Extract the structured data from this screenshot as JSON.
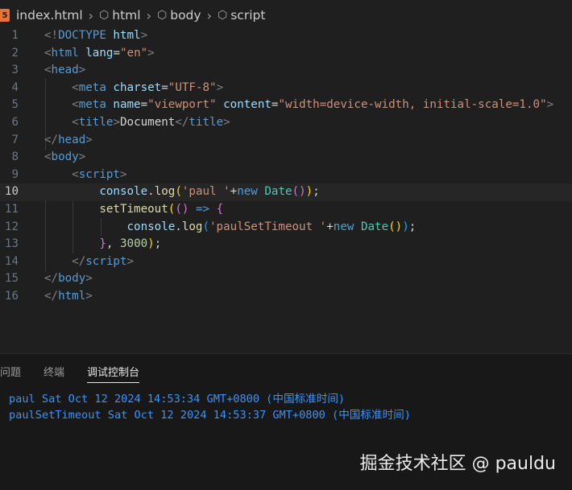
{
  "breadcrumb": {
    "file_icon_text": "5",
    "items": [
      "index.html",
      "html",
      "body",
      "script"
    ]
  },
  "editor": {
    "current_line": 10,
    "lines": [
      {
        "num": "1",
        "tokens": [
          [
            "<!",
            "t-punct"
          ],
          [
            "DOCTYPE",
            "t-tag"
          ],
          [
            " html",
            "t-attr"
          ],
          [
            ">",
            "t-punct"
          ]
        ]
      },
      {
        "num": "2",
        "tokens": [
          [
            "<",
            "t-punct"
          ],
          [
            "html",
            "t-tag"
          ],
          [
            " lang",
            "t-attr"
          ],
          [
            "=",
            "t-text"
          ],
          [
            "\"en\"",
            "t-str"
          ],
          [
            ">",
            "t-punct"
          ]
        ]
      },
      {
        "num": "3",
        "tokens": [
          [
            "<",
            "t-punct"
          ],
          [
            "head",
            "t-tag"
          ],
          [
            ">",
            "t-punct"
          ]
        ]
      },
      {
        "num": "4",
        "tokens": [
          [
            "    ",
            "t-text"
          ],
          [
            "<",
            "t-punct"
          ],
          [
            "meta",
            "t-tag"
          ],
          [
            " charset",
            "t-attr"
          ],
          [
            "=",
            "t-text"
          ],
          [
            "\"UTF-8\"",
            "t-str"
          ],
          [
            ">",
            "t-punct"
          ]
        ]
      },
      {
        "num": "5",
        "tokens": [
          [
            "    ",
            "t-text"
          ],
          [
            "<",
            "t-punct"
          ],
          [
            "meta",
            "t-tag"
          ],
          [
            " name",
            "t-attr"
          ],
          [
            "=",
            "t-text"
          ],
          [
            "\"viewport\"",
            "t-str"
          ],
          [
            " content",
            "t-attr"
          ],
          [
            "=",
            "t-text"
          ],
          [
            "\"width=device-width, initial-scale=1.0\"",
            "t-str"
          ],
          [
            ">",
            "t-punct"
          ]
        ]
      },
      {
        "num": "6",
        "tokens": [
          [
            "    ",
            "t-text"
          ],
          [
            "<",
            "t-punct"
          ],
          [
            "title",
            "t-tag"
          ],
          [
            ">",
            "t-punct"
          ],
          [
            "Document",
            "t-text"
          ],
          [
            "</",
            "t-punct"
          ],
          [
            "title",
            "t-tag"
          ],
          [
            ">",
            "t-punct"
          ]
        ]
      },
      {
        "num": "7",
        "tokens": [
          [
            "</",
            "t-punct"
          ],
          [
            "head",
            "t-tag"
          ],
          [
            ">",
            "t-punct"
          ]
        ]
      },
      {
        "num": "8",
        "tokens": [
          [
            "<",
            "t-punct"
          ],
          [
            "body",
            "t-tag"
          ],
          [
            ">",
            "t-punct"
          ]
        ]
      },
      {
        "num": "9",
        "tokens": [
          [
            "    ",
            "t-text"
          ],
          [
            "<",
            "t-punct"
          ],
          [
            "script",
            "t-tag"
          ],
          [
            ">",
            "t-punct"
          ]
        ]
      },
      {
        "num": "10",
        "tokens": [
          [
            "        ",
            "t-text"
          ],
          [
            "console",
            "t-attr"
          ],
          [
            ".",
            "t-text"
          ],
          [
            "log",
            "t-fn"
          ],
          [
            "(",
            "t-br1"
          ],
          [
            "'paul '",
            "t-str"
          ],
          [
            "+",
            "t-text"
          ],
          [
            "new",
            "t-kw"
          ],
          [
            " ",
            "t-text"
          ],
          [
            "Date",
            "t-cls"
          ],
          [
            "(",
            "t-br2"
          ],
          [
            ")",
            "t-br2"
          ],
          [
            ")",
            "t-br1"
          ],
          [
            ";",
            "t-text"
          ]
        ]
      },
      {
        "num": "11",
        "tokens": [
          [
            "        ",
            "t-text"
          ],
          [
            "setTimeout",
            "t-fn"
          ],
          [
            "(",
            "t-br1"
          ],
          [
            "(",
            "t-br2"
          ],
          [
            ")",
            "t-br2"
          ],
          [
            " ",
            "t-text"
          ],
          [
            "=>",
            "t-kw"
          ],
          [
            " ",
            "t-text"
          ],
          [
            "{",
            "t-br2"
          ]
        ]
      },
      {
        "num": "12",
        "tokens": [
          [
            "            ",
            "t-text"
          ],
          [
            "console",
            "t-attr"
          ],
          [
            ".",
            "t-text"
          ],
          [
            "log",
            "t-fn"
          ],
          [
            "(",
            "t-br3"
          ],
          [
            "'paulSetTimeout '",
            "t-str"
          ],
          [
            "+",
            "t-text"
          ],
          [
            "new",
            "t-kw"
          ],
          [
            " ",
            "t-text"
          ],
          [
            "Date",
            "t-cls"
          ],
          [
            "(",
            "t-br1"
          ],
          [
            ")",
            "t-br1"
          ],
          [
            ")",
            "t-br3"
          ],
          [
            ";",
            "t-text"
          ]
        ]
      },
      {
        "num": "13",
        "tokens": [
          [
            "        ",
            "t-text"
          ],
          [
            "}",
            "t-br2"
          ],
          [
            ", ",
            "t-text"
          ],
          [
            "3000",
            "t-num"
          ],
          [
            ")",
            "t-br1"
          ],
          [
            ";",
            "t-text"
          ]
        ]
      },
      {
        "num": "14",
        "tokens": [
          [
            "    ",
            "t-text"
          ],
          [
            "</",
            "t-punct"
          ],
          [
            "script",
            "t-tag"
          ],
          [
            ">",
            "t-punct"
          ]
        ]
      },
      {
        "num": "15",
        "tokens": [
          [
            "</",
            "t-punct"
          ],
          [
            "body",
            "t-tag"
          ],
          [
            ">",
            "t-punct"
          ]
        ]
      },
      {
        "num": "16",
        "tokens": [
          [
            "</",
            "t-punct"
          ],
          [
            "html",
            "t-tag"
          ],
          [
            ">",
            "t-punct"
          ]
        ]
      }
    ]
  },
  "panel": {
    "tabs": [
      {
        "label": "问题",
        "active": false
      },
      {
        "label": "终端",
        "active": false
      },
      {
        "label": "调试控制台",
        "active": true
      }
    ],
    "console": [
      "paul Sat Oct 12 2024 14:53:34 GMT+0800 (中国标准时间)",
      "paulSetTimeout Sat Oct 12 2024 14:53:37 GMT+0800 (中国标准时间)"
    ]
  },
  "watermark": "掘金技术社区 @ pauldu"
}
